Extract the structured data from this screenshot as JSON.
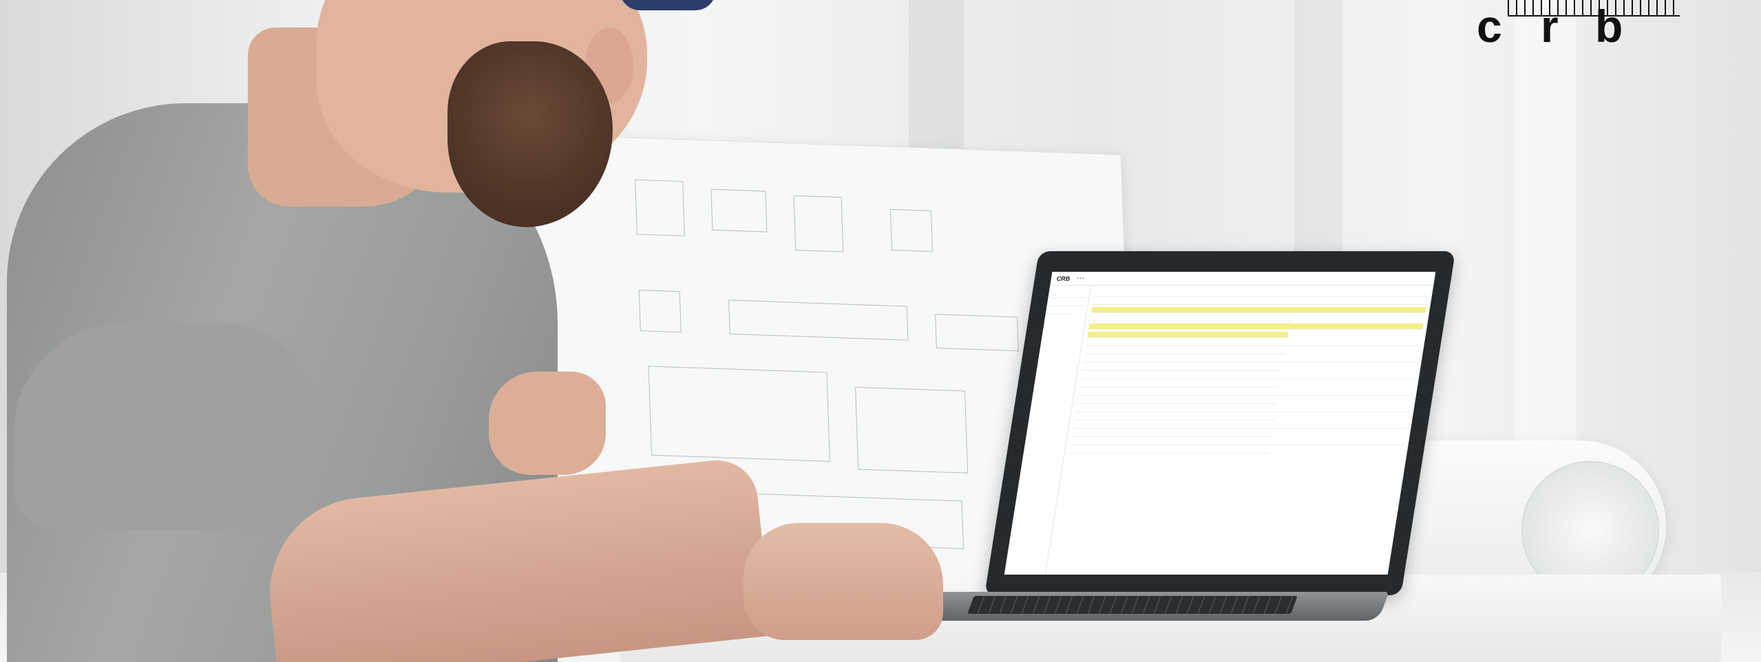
{
  "logo": {
    "letters": [
      "c",
      "r",
      "b"
    ],
    "color": "#111111"
  },
  "laptop_screen": {
    "app_name": "CRB",
    "highlight_color": "#f4ee8a"
  },
  "colors": {
    "shirt": "#9a9c9c",
    "cap": "#2c3d6b",
    "laptop": "#262a2d"
  }
}
